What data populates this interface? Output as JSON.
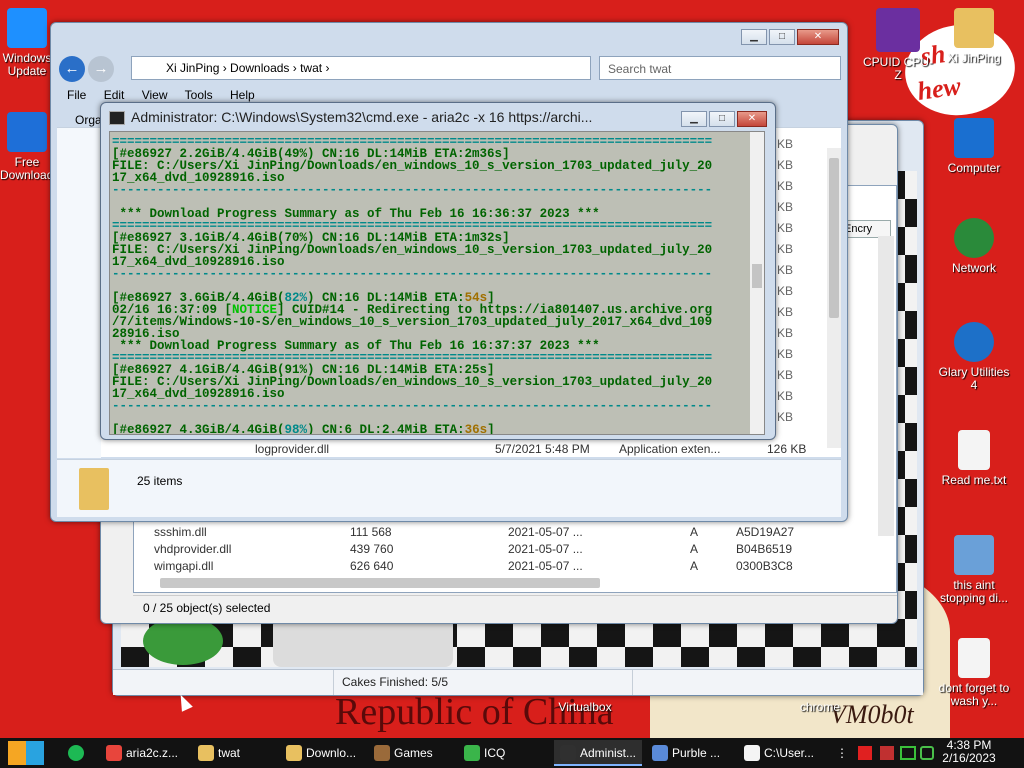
{
  "wallpaper": {
    "banner_text": "Republic of China",
    "corner_text": "VM0b0t",
    "sign_line1": "sh",
    "sign_line2": "hew"
  },
  "desktop_icons_left": [
    {
      "label": "Windows Update",
      "icon": "windows-logo-icon",
      "color": "#1e90ff"
    },
    {
      "label": "Free Download...",
      "icon": "download-shield-icon",
      "color": "#1e6fd8"
    }
  ],
  "desktop_icons_right": [
    {
      "label": "CPUID CPU-Z",
      "icon": "cpu-z-icon",
      "color": "#6b2fa0"
    },
    {
      "label": "Xi JinPing",
      "icon": "user-folder-icon",
      "color": "#e8c060"
    },
    {
      "label": "Computer",
      "icon": "computer-icon",
      "color": "#1a6fd0"
    },
    {
      "label": "Network",
      "icon": "network-globe-icon",
      "color": "#2a8a3a"
    },
    {
      "label": "Glary Utilities 4",
      "icon": "glary-utilities-icon",
      "color": "#1d70c8"
    },
    {
      "label": "Read me.txt",
      "icon": "text-file-icon",
      "color": "#f4f4f4"
    },
    {
      "label": "this aint stopping di...",
      "icon": "disk-computer-icon",
      "color": "#6aa0d8"
    },
    {
      "label": "dont forget to wash y...",
      "icon": "calendar-file-icon",
      "color": "#f4f4f4"
    }
  ],
  "desktop_bottom_labels": {
    "virtualbox": "Virtualbox",
    "chrome": "chrome"
  },
  "explorer": {
    "address": [
      "Xi JinPing",
      "Downloads",
      "twat"
    ],
    "search_placeholder": "Search twat",
    "menu": [
      "File",
      "Edit",
      "View",
      "Tools",
      "Help"
    ],
    "organize": "Orga",
    "visible_file": {
      "name": "logprovider.dll",
      "date": "5/7/2021 5:48 PM",
      "type": "Application exten...",
      "size": "126 KB"
    },
    "sizes": [
      "5 KB",
      "6 KB",
      "5 KB",
      "2 KB",
      "5 KB",
      "9 KB",
      "6 KB",
      "5 KB",
      "6 KB",
      "2 KB",
      "6 KB",
      "7 KB",
      "5 KB",
      "9 KB"
    ],
    "status": "25 items"
  },
  "archive": {
    "col_fragment": "Encry",
    "rows": [
      {
        "name": "ssshim.dll",
        "size": "111 568",
        "date": "2021-05-07 ...",
        "attr": "A",
        "crc": "A5D19A27"
      },
      {
        "name": "vhdprovider.dll",
        "size": "439 760",
        "date": "2021-05-07 ...",
        "attr": "A",
        "crc": "B04B6519"
      },
      {
        "name": "wimgapi.dll",
        "size": "626 640",
        "date": "2021-05-07 ...",
        "attr": "A",
        "crc": "0300B3C8"
      }
    ],
    "status": "0 / 25 object(s) selected"
  },
  "game": {
    "status": "Cakes Finished: 5/5"
  },
  "cmd": {
    "title": "Administrator: C:\\Windows\\System32\\cmd.exe - aria2c  -x 16 https://archi...",
    "sep": "================================================================================",
    "dash": "--------------------------------------------------------------------------------",
    "p1": "[#e86927 2.2GiB/4.4GiB(49%) CN:16 DL:14MiB ETA:2m36s]",
    "f1": "FILE: C:/Users/Xi JinPing/Downloads/en_windows_10_s_version_1703_updated_july_20",
    "f1b": "17_x64_dvd_10928916.iso",
    "sum1": " *** Download Progress Summary as of Thu Feb 16 16:36:37 2023 ***",
    "p2": "[#e86927 3.1GiB/4.4GiB(70%) CN:16 DL:14MiB ETA:1m32s]",
    "p3a": "[#e86927 3.6GiB/4.4GiB(",
    "p3pct": "82%",
    "p3b": ") CN:16 DL:14MiB ETA:",
    "p3eta": "54s",
    "p3c": "]",
    "notice_ts": "02/16 16:37:09 [",
    "notice_tag": "NOTICE",
    "notice_rest": "] CUID#14 - Redirecting to https://ia801407.us.archive.org",
    "notice2": "/7/items/Windows-10-S/en_windows_10_s_version_1703_updated_july_2017_x64_dvd_109",
    "notice3": "28916.iso",
    "sum2": " *** Download Progress Summary as of Thu Feb 16 16:37:37 2023 ***",
    "p4": "[#e86927 4.1GiB/4.4GiB(91%) CN:16 DL:14MiB ETA:25s]",
    "p5a": "[#e86927 4.3GiB/4.4GiB(",
    "p5pct": "98%",
    "p5b": ") CN:6 DL:2.4MiB ETA:",
    "p5eta": "36s",
    "p5c": "]"
  },
  "taskbar": {
    "items": [
      {
        "label": "aria2c.z...",
        "icon": "chrome-icon",
        "color": "#e8453c"
      },
      {
        "label": "twat",
        "icon": "folder-icon",
        "color": "#e8c060"
      },
      {
        "label": "Downlo...",
        "icon": "folder-icon",
        "color": "#e8c060"
      },
      {
        "label": "Games",
        "icon": "games-icon",
        "color": "#9a6a3a"
      },
      {
        "label": "ICQ",
        "icon": "icq-flower-icon",
        "color": "#3ab54a"
      },
      {
        "label": "Administ...",
        "icon": "cmd-icon",
        "color": "#303030"
      },
      {
        "label": "Purble ...",
        "icon": "purble-icon",
        "color": "#5a8ad8"
      },
      {
        "label": "C:\\User...",
        "icon": "seven-zip-icon",
        "color": "#f4f4f4"
      }
    ],
    "time": "4:38 PM",
    "date": "2/16/2023"
  }
}
